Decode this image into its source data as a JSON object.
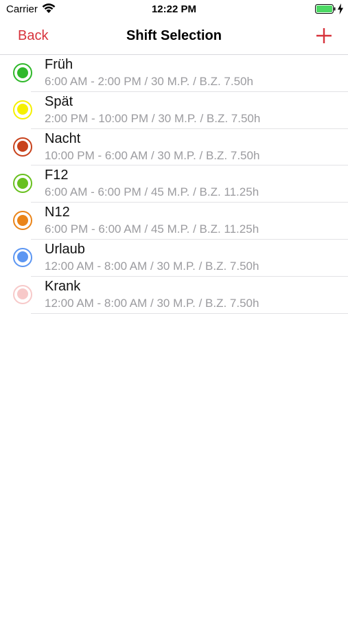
{
  "status_bar": {
    "carrier": "Carrier",
    "time": "12:22 PM",
    "battery_color": "#4cd964"
  },
  "nav": {
    "back_label": "Back",
    "title": "Shift Selection",
    "add_icon": "plus-icon",
    "accent_color": "#d7323b"
  },
  "shifts": [
    {
      "name": "Früh",
      "detail": "6:00 AM - 2:00 PM / 30 M.P. / B.Z. 7.50h",
      "color": "#2fb82a"
    },
    {
      "name": "Spät",
      "detail": "2:00 PM - 10:00 PM / 30 M.P. / B.Z. 7.50h",
      "color": "#f5f000"
    },
    {
      "name": "Nacht",
      "detail": "10:00 PM - 6:00 AM / 30 M.P. / B.Z. 7.50h",
      "color": "#c8421c"
    },
    {
      "name": "F12",
      "detail": "6:00 AM - 6:00 PM / 45 M.P. / B.Z. 11.25h",
      "color": "#68c01e"
    },
    {
      "name": "N12",
      "detail": "6:00 PM - 6:00 AM / 45 M.P. / B.Z. 11.25h",
      "color": "#ea8418"
    },
    {
      "name": "Urlaub",
      "detail": "12:00 AM - 8:00 AM / 30 M.P. / B.Z. 7.50h",
      "color": "#5c96f2"
    },
    {
      "name": "Krank",
      "detail": "12:00 AM - 8:00 AM / 30 M.P. / B.Z. 7.50h",
      "color": "#f7c9c9"
    }
  ]
}
